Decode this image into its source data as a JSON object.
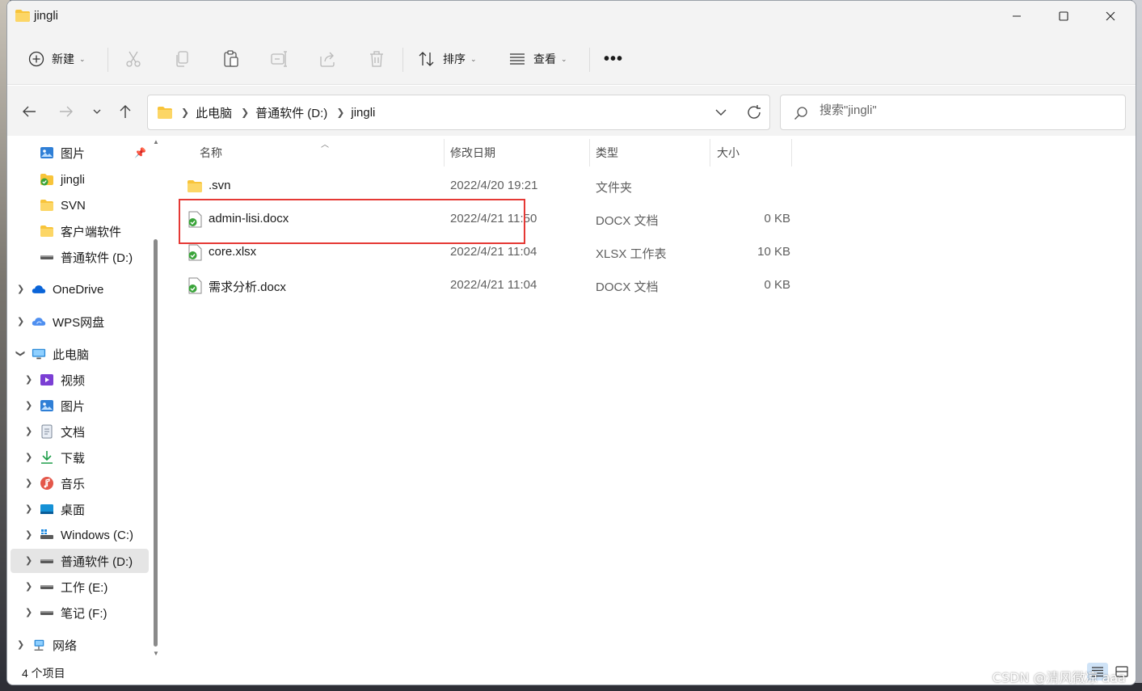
{
  "window": {
    "title": "jingli"
  },
  "window_controls": {
    "minimize": "—",
    "maximize": "☐",
    "close": "✕"
  },
  "toolbar": {
    "new_label": "新建",
    "sort_label": "排序",
    "view_label": "查看",
    "more_label": "•••"
  },
  "address": {
    "crumbs": [
      "此电脑",
      "普通软件 (D:)",
      "jingli"
    ]
  },
  "search": {
    "placeholder": "搜索\"jingli\""
  },
  "sidebar": {
    "quick": [
      {
        "label": "图片",
        "icon": "pictures-icon",
        "pinned": true
      },
      {
        "label": "jingli",
        "icon": "svn-folder-icon"
      },
      {
        "label": "SVN",
        "icon": "folder-icon"
      },
      {
        "label": "客户端软件",
        "icon": "folder-icon"
      },
      {
        "label": "普通软件 (D:)",
        "icon": "drive-icon"
      }
    ],
    "onedrive": "OneDrive",
    "wps": "WPS网盘",
    "thispc": "此电脑",
    "pc_children": [
      {
        "label": "视频",
        "icon": "videos-icon"
      },
      {
        "label": "图片",
        "icon": "pictures-icon"
      },
      {
        "label": "文档",
        "icon": "documents-icon"
      },
      {
        "label": "下载",
        "icon": "downloads-icon"
      },
      {
        "label": "音乐",
        "icon": "music-icon"
      },
      {
        "label": "桌面",
        "icon": "desktop-icon"
      },
      {
        "label": "Windows (C:)",
        "icon": "windows-drive-icon"
      },
      {
        "label": "普通软件 (D:)",
        "icon": "drive-icon",
        "selected": true
      },
      {
        "label": "工作 (E:)",
        "icon": "drive-icon"
      },
      {
        "label": "笔记 (F:)",
        "icon": "drive-icon"
      }
    ],
    "network": "网络"
  },
  "columns": {
    "name": "名称",
    "date": "修改日期",
    "type": "类型",
    "size": "大小"
  },
  "files": [
    {
      "name": ".svn",
      "date": "2022/4/20 19:21",
      "type": "文件夹",
      "size": "",
      "icon": "folder-icon"
    },
    {
      "name": "admin-lisi.docx",
      "date": "2022/4/21 11:50",
      "type": "DOCX 文档",
      "size": "0 KB",
      "icon": "svn-file-icon"
    },
    {
      "name": "core.xlsx",
      "date": "2022/4/21 11:04",
      "type": "XLSX 工作表",
      "size": "10 KB",
      "icon": "svn-file-icon"
    },
    {
      "name": "需求分析.docx",
      "date": "2022/4/21 11:04",
      "type": "DOCX 文档",
      "size": "0 KB",
      "icon": "svn-file-icon"
    }
  ],
  "status": {
    "item_count": "4 个项目"
  },
  "watermark": "CSDN @清风微凉 aaa",
  "colors": {
    "accent": "#0067c0",
    "highlight": "#e53935",
    "folder": "#f8c43a",
    "svn_check": "#3aa43a"
  }
}
